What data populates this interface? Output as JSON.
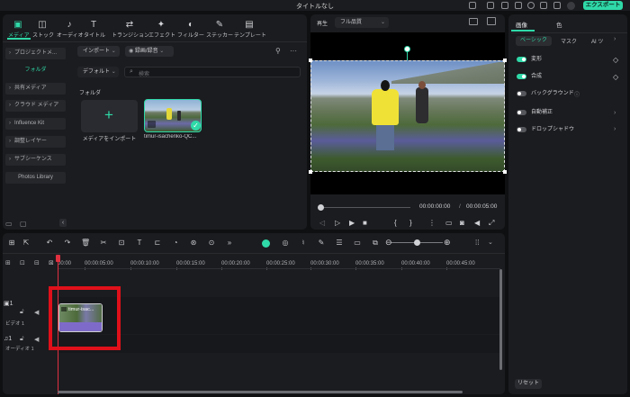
{
  "window": {
    "title": "タイトルなし",
    "export_label": "エクスポート"
  },
  "toolbar": {
    "items": [
      {
        "label": "メディア",
        "icon": "media-icon",
        "glyph": "▣"
      },
      {
        "label": "ストック",
        "icon": "stock-icon",
        "glyph": "◫"
      },
      {
        "label": "オーディオ",
        "icon": "audio-icon",
        "glyph": "♪"
      },
      {
        "label": "タイトル",
        "icon": "title-icon",
        "glyph": "T"
      },
      {
        "label": "トランジション",
        "icon": "transition-icon",
        "glyph": "⇄"
      },
      {
        "label": "エフェクト",
        "icon": "effect-icon",
        "glyph": "✦"
      },
      {
        "label": "フィルター",
        "icon": "filter-icon",
        "glyph": "◐"
      },
      {
        "label": "ステッカー",
        "icon": "sticker-icon",
        "glyph": "✎"
      },
      {
        "label": "テンプレート",
        "icon": "template-icon",
        "glyph": "▤"
      }
    ]
  },
  "sidebar": {
    "items": [
      {
        "label": "プロジェクトメ..."
      },
      {
        "label": "フォルダ"
      },
      {
        "label": "共有メディア"
      },
      {
        "label": "クラウド メディア"
      },
      {
        "label": "Influence Kit"
      },
      {
        "label": "調整レイヤー"
      },
      {
        "label": "サブシーケンス"
      },
      {
        "label": "Photos Library"
      }
    ]
  },
  "media": {
    "import_label": "インポート",
    "record_label": "録画/録音",
    "sort_label": "デフォルト",
    "search_placeholder": "検索",
    "folder_label": "フォルダ",
    "import_tile_label": "メディアをインポート",
    "clip_label": "timur-isachenko-QC..."
  },
  "preview": {
    "play_label": "再生",
    "quality_label": "フル品質",
    "current_time": "00:00:00:00",
    "separator": "/",
    "total_time": "00:00:05:00"
  },
  "right_panel": {
    "tab_image": "画像",
    "tab_color": "色",
    "subtabs": [
      "ベーシック",
      "マスク",
      "AI ツ"
    ],
    "rows": [
      {
        "label": "変形",
        "on": true
      },
      {
        "label": "合成",
        "on": true
      },
      {
        "label": "バックグラウンド",
        "on": false
      },
      {
        "label": "自動補正",
        "on": false
      },
      {
        "label": "ドロップシャドウ",
        "on": false
      }
    ],
    "reset_label": "リセット"
  },
  "timeline": {
    "ruler": [
      "00:00",
      "00:00:05:00",
      "00:00:10:00",
      "00:00:15:00",
      "00:00:20:00",
      "00:00:25:00",
      "00:00:30:00",
      "00:00:35:00",
      "00:00:40:00",
      "00:00:45:00"
    ],
    "video_track_label": "ビデオ 1",
    "audio_track_label": "オーディオ 1",
    "clip_label": "timur-isac..."
  },
  "colors": {
    "accent": "#2fd9a8",
    "highlight": "#e0101a",
    "playhead": "#e03040"
  }
}
